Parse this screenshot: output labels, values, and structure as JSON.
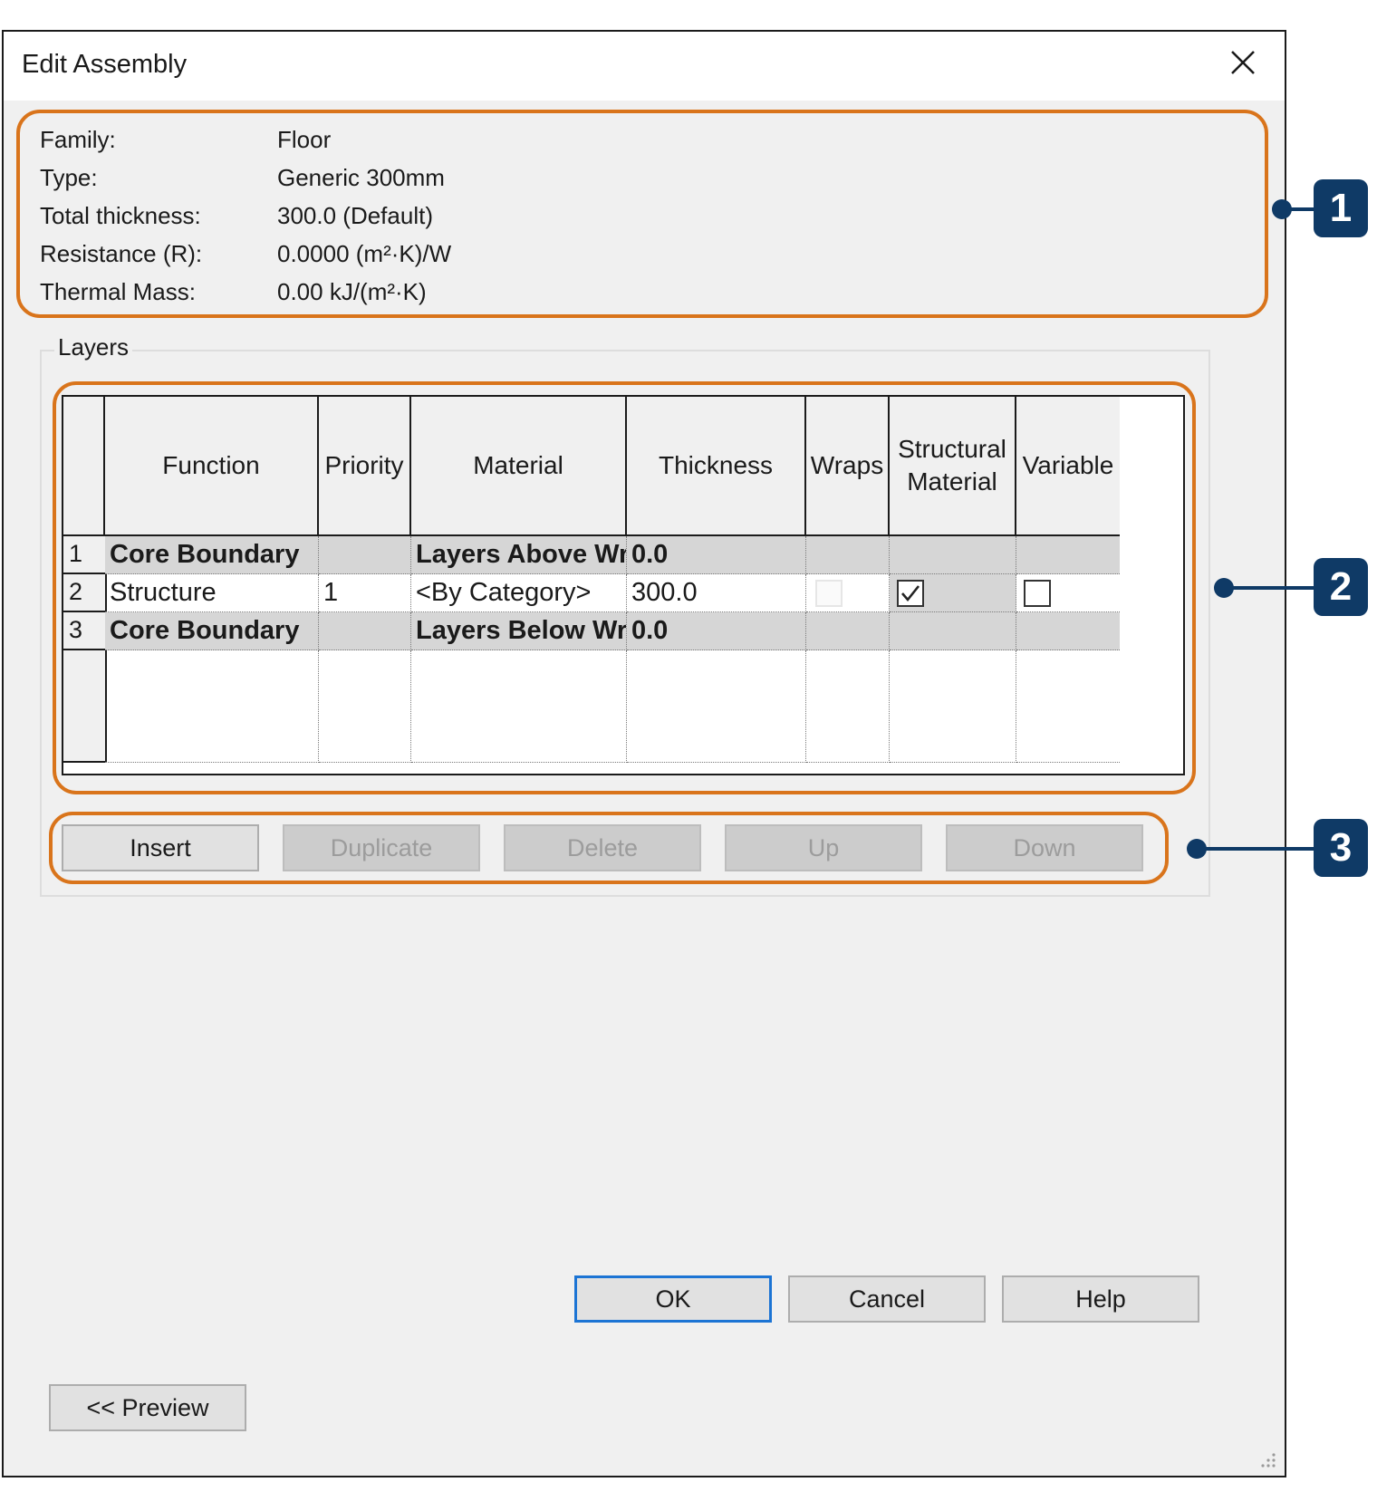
{
  "window": {
    "title": "Edit Assembly"
  },
  "info": {
    "rows": [
      {
        "label": "Family:",
        "value": "Floor"
      },
      {
        "label": "Type:",
        "value": "Generic 300mm"
      },
      {
        "label": "Total thickness:",
        "value": "300.0 (Default)"
      },
      {
        "label": "Resistance (R):",
        "value": "0.0000 (m²·K)/W"
      },
      {
        "label": "Thermal Mass:",
        "value": "0.00 kJ/(m²·K)"
      }
    ]
  },
  "layers": {
    "group_label": "Layers",
    "columns": [
      "Function",
      "Priority",
      "Material",
      "Thickness",
      "Wraps",
      "Structural\nMaterial",
      "Variable"
    ],
    "rows": [
      {
        "num": "1",
        "function": "Core Boundary",
        "priority": "",
        "material": "Layers Above Wr",
        "thickness": "0.0"
      },
      {
        "num": "2",
        "function": "Structure",
        "priority": "1",
        "material": "<By Category>",
        "thickness": "300.0",
        "wraps": false,
        "structural": true,
        "variable": false
      },
      {
        "num": "3",
        "function": "Core Boundary",
        "priority": "",
        "material": "Layers Below Wra",
        "thickness": "0.0"
      }
    ]
  },
  "layer_buttons": {
    "insert": "Insert",
    "duplicate": "Duplicate",
    "delete": "Delete",
    "up": "Up",
    "down": "Down"
  },
  "footer": {
    "ok": "OK",
    "cancel": "Cancel",
    "help": "Help",
    "preview": "<< Preview"
  },
  "callouts": [
    "1",
    "2",
    "3"
  ],
  "colors": {
    "callout_outline": "#d9741b",
    "marker": "#0f3a66",
    "default_button_border": "#1c74d4"
  }
}
